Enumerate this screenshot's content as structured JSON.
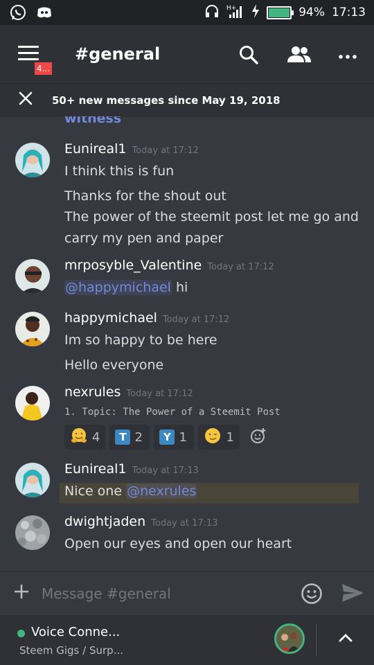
{
  "status_bar": {
    "battery_percent": "94%",
    "battery_level": 0.94,
    "time": "17:13",
    "icons": [
      "whatsapp-icon",
      "discord-icon",
      "headset-icon",
      "signal-icon",
      "charging-icon",
      "battery-icon"
    ]
  },
  "header": {
    "channel": "#general",
    "badge": "4...",
    "icons": [
      "menu-icon",
      "search-icon",
      "members-icon",
      "more-icon"
    ]
  },
  "banner": {
    "text": "50+ new messages since May 19, 2018"
  },
  "messages": {
    "partial_text": "witness",
    "m1": {
      "author": "Eunireal1",
      "time": "Today at 17:12",
      "line1": "I think this is fun",
      "line2": "Thanks for the shout out",
      "line3": "The power of the steemit post let me go and",
      "line4": "carry my pen and paper"
    },
    "m2": {
      "author": "mrposyble_Valentine",
      "time": "Today at 17:12",
      "mention": "@happymichael",
      "text": " hi"
    },
    "m3": {
      "author": "happymichael",
      "time": "Today at 17:12",
      "line1": "Im so happy to be here",
      "line2": "Hello everyone"
    },
    "m4": {
      "author": "nexrules",
      "time": "Today at 17:12",
      "code": "1. Topic: The Power of a Steemit Post",
      "reactions": [
        {
          "icon": "hugging-face-emoji",
          "count": "4"
        },
        {
          "icon": "t-letter-emoji",
          "letter": "T",
          "count": "2"
        },
        {
          "icon": "y-letter-emoji",
          "letter": "Y",
          "count": "1"
        },
        {
          "icon": "winking-face-emoji",
          "count": "1"
        }
      ]
    },
    "m5": {
      "author": "Eunireal1",
      "time": "Today at 17:13",
      "text": "Nice one ",
      "mention": "@nexrules"
    },
    "m6": {
      "author": "dwightjaden",
      "time": "Today at 17:13",
      "text": "Open our eyes and open our heart"
    }
  },
  "input": {
    "placeholder": "Message #general"
  },
  "voice": {
    "title": "Voice Conne...",
    "subtitle": "Steem Gigs / Surp..."
  },
  "colors": {
    "background": "#36393f",
    "header": "#2f3136",
    "mention": "#7289da",
    "voice_green": "#43b581",
    "badge_red": "#f04747"
  }
}
